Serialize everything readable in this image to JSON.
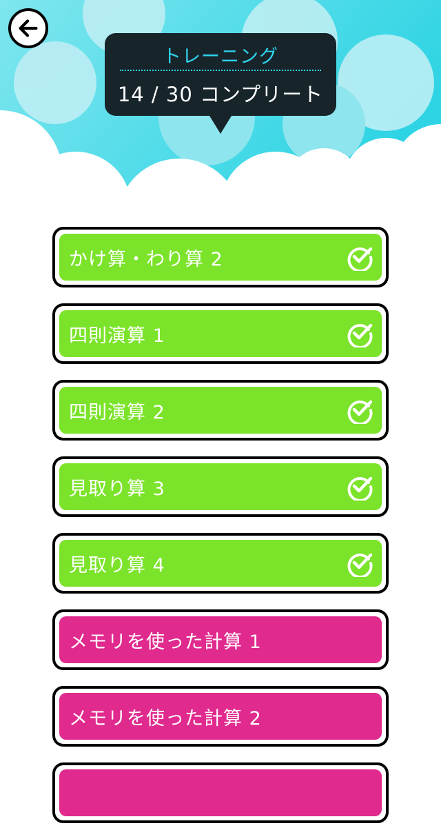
{
  "header": {
    "title": "トレーニング",
    "progress": "14 / 30 コンプリート"
  },
  "colors": {
    "sky": "#2fd4ee",
    "completed": "#7be32a",
    "incomplete": "#e02a8e",
    "tooltip": "#17252b"
  },
  "icons": {
    "back": "arrow-left-icon",
    "done": "check-circle-icon"
  },
  "lessons": [
    {
      "label": "かけ算・わり算 2",
      "completed": true
    },
    {
      "label": "四則演算 1",
      "completed": true
    },
    {
      "label": "四則演算 2",
      "completed": true
    },
    {
      "label": "見取り算 3",
      "completed": true
    },
    {
      "label": "見取り算 4",
      "completed": true
    },
    {
      "label": "メモリを使った計算 1",
      "completed": false
    },
    {
      "label": "メモリを使った計算 2",
      "completed": false
    },
    {
      "label": "",
      "completed": false
    }
  ]
}
